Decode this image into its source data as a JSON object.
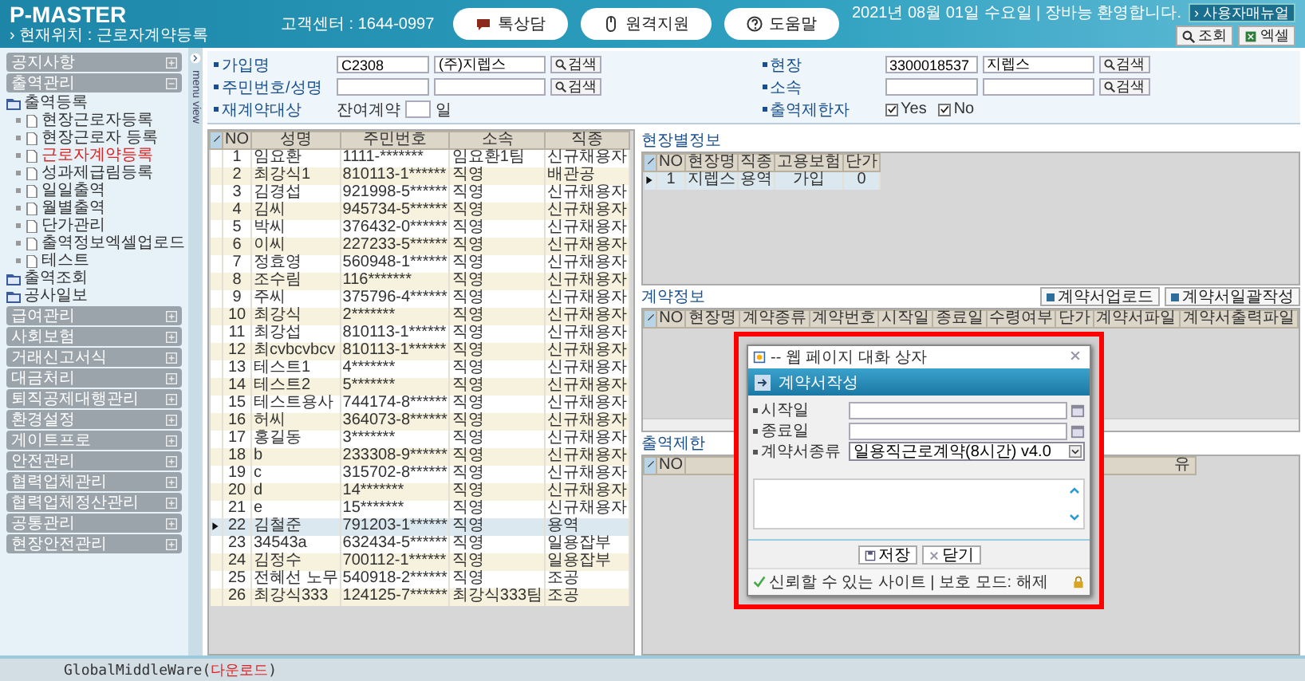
{
  "header": {
    "logo": "P-MASTER",
    "breadcrumb": "› 현재위치 : 근로자계약등록",
    "support": "고객센터 : 1644-0997",
    "pills": [
      {
        "kind": "chat",
        "label": "톡상담"
      },
      {
        "kind": "mouse",
        "label": "원격지원"
      },
      {
        "kind": "help",
        "label": "도움말"
      }
    ],
    "greeting": "2021년 08월 01일 수요일 | 장바능 환영합니다.",
    "manual_button": "› 사용자매뉴얼",
    "tools": [
      {
        "kind": "search",
        "label": "조회"
      },
      {
        "kind": "excel",
        "label": "엑셀"
      }
    ]
  },
  "sidebar": {
    "toggle_label": "menu view",
    "sections": [
      {
        "label": "공지사항",
        "expanded": false
      },
      {
        "label": "출역관리",
        "expanded": true,
        "children": [
          {
            "label": "출역등록",
            "children": [
              {
                "label": "현장근로자등록",
                "selected": false
              },
              {
                "label": "현장근로자 등록",
                "selected": false
              },
              {
                "label": "근로자계약등록",
                "selected": true
              },
              {
                "label": "성과제급림등록",
                "selected": false
              },
              {
                "label": "일일출역",
                "selected": false
              },
              {
                "label": "월별출역",
                "selected": false
              },
              {
                "label": "단가관리",
                "selected": false
              },
              {
                "label": "출역정보엑셀업로드",
                "selected": false
              },
              {
                "label": "테스트",
                "selected": false
              }
            ]
          },
          {
            "label": "출역조회"
          },
          {
            "label": "공사일보"
          }
        ]
      },
      {
        "label": "급여관리",
        "expanded": false
      },
      {
        "label": "사회보험",
        "expanded": false
      },
      {
        "label": "거래신고서식",
        "expanded": false
      },
      {
        "label": "대금처리",
        "expanded": false
      },
      {
        "label": "퇴직공제대행관리",
        "expanded": false
      },
      {
        "label": "환경설정",
        "expanded": false
      },
      {
        "label": "게이트프로",
        "expanded": false
      },
      {
        "label": "안전관리",
        "expanded": false
      },
      {
        "label": "협력업체관리",
        "expanded": false
      },
      {
        "label": "협력업체정산관리",
        "expanded": false
      },
      {
        "label": "공통관리",
        "expanded": false
      },
      {
        "label": "현장안전관리",
        "expanded": false
      }
    ]
  },
  "filters": [
    {
      "kind": "lookup",
      "label": "가입명",
      "code": "C2308",
      "name": "(주)지렙스",
      "button": "검색"
    },
    {
      "kind": "lookup",
      "label": "현장",
      "code": "3300018537",
      "name": "지렙스",
      "button": "검색"
    },
    {
      "kind": "lookup",
      "label": "주민번호/성명",
      "button": "검색"
    },
    {
      "kind": "lookup",
      "label": "소속",
      "button": "검색"
    },
    {
      "kind": "days",
      "label": "재계약대상",
      "prefix": "잔여계약",
      "unit": "일"
    },
    {
      "kind": "checks",
      "label": "출역제한자",
      "options": [
        {
          "label": "Yes",
          "checked": true
        },
        {
          "label": "No",
          "checked": true
        }
      ]
    }
  ],
  "workers": {
    "columns": [
      "NO",
      "성명",
      "주민번호",
      "소속",
      "직종"
    ],
    "rows": [
      {
        "cells": [
          "1",
          "임요환",
          "1111-*******",
          "임요환1팀",
          "신규채용자"
        ],
        "selected": false
      },
      {
        "cells": [
          "2",
          "최강식1",
          "810113-1******",
          "직영",
          "배관공"
        ],
        "selected": false
      },
      {
        "cells": [
          "3",
          "김경섭",
          "921998-5******",
          "직영",
          "신규채용자"
        ],
        "selected": false
      },
      {
        "cells": [
          "4",
          "김씨",
          "945734-5******",
          "직영",
          "신규채용자"
        ],
        "selected": false
      },
      {
        "cells": [
          "5",
          "박씨",
          "376432-0******",
          "직영",
          "신규채용자"
        ],
        "selected": false
      },
      {
        "cells": [
          "6",
          "이씨",
          "227233-5******",
          "직영",
          "신규채용자"
        ],
        "selected": false
      },
      {
        "cells": [
          "7",
          "정효영",
          "560948-1******",
          "직영",
          "신규채용자"
        ],
        "selected": false
      },
      {
        "cells": [
          "8",
          "조수림",
          "116*******",
          "직영",
          "신규채용자"
        ],
        "selected": false
      },
      {
        "cells": [
          "9",
          "주씨",
          "375796-4******",
          "직영",
          "신규채용자"
        ],
        "selected": false
      },
      {
        "cells": [
          "10",
          "최강식",
          "2*******",
          "직영",
          "신규채용자"
        ],
        "selected": false
      },
      {
        "cells": [
          "11",
          "최강섭",
          "810113-1******",
          "직영",
          "신규채용자"
        ],
        "selected": false
      },
      {
        "cells": [
          "12",
          "최cvbcvbcv",
          "810113-1******",
          "직영",
          "신규채용자"
        ],
        "selected": false
      },
      {
        "cells": [
          "13",
          "테스트1",
          "4*******",
          "직영",
          "신규채용자"
        ],
        "selected": false
      },
      {
        "cells": [
          "14",
          "테스트2",
          "5*******",
          "직영",
          "신규채용자"
        ],
        "selected": false
      },
      {
        "cells": [
          "15",
          "테스트용사",
          "744174-8******",
          "직영",
          "신규채용자"
        ],
        "selected": false
      },
      {
        "cells": [
          "16",
          "허씨",
          "364073-8******",
          "직영",
          "신규채용자"
        ],
        "selected": false
      },
      {
        "cells": [
          "17",
          "홍길동",
          "3*******",
          "직영",
          "신규채용자"
        ],
        "selected": false
      },
      {
        "cells": [
          "18",
          "b",
          "233308-9******",
          "직영",
          "신규채용자"
        ],
        "selected": false
      },
      {
        "cells": [
          "19",
          "c",
          "315702-8******",
          "직영",
          "신규채용자"
        ],
        "selected": false
      },
      {
        "cells": [
          "20",
          "d",
          "14*******",
          "직영",
          "신규채용자"
        ],
        "selected": false
      },
      {
        "cells": [
          "21",
          "e",
          "15*******",
          "직영",
          "신규채용자"
        ],
        "selected": false
      },
      {
        "cells": [
          "22",
          "김철준",
          "791203-1******",
          "직영",
          "용역"
        ],
        "selected": true
      },
      {
        "cells": [
          "23",
          "34543a",
          "632434-5******",
          "직영",
          "일용잡부"
        ],
        "selected": false
      },
      {
        "cells": [
          "24",
          "김정수",
          "700112-1******",
          "직영",
          "일용잡부"
        ],
        "selected": false
      },
      {
        "cells": [
          "25",
          "전혜선 노무",
          "540918-2******",
          "직영",
          "조공"
        ],
        "selected": false
      },
      {
        "cells": [
          "26",
          "최강식333",
          "124125-7******",
          "최강식333팀",
          "조공"
        ],
        "selected": false
      }
    ]
  },
  "site_info": {
    "title": "현장별정보",
    "columns": [
      "NO",
      "현장명",
      "직종",
      "고용보험",
      "단가"
    ],
    "rows": [
      {
        "cells": [
          "1",
          "지렙스",
          "용역",
          "가입",
          "0"
        ],
        "selected": true
      }
    ]
  },
  "contract_info": {
    "title": "계약정보",
    "buttons": [
      "계약서업로드",
      "계약서일괄작성"
    ],
    "columns": [
      "NO",
      "현장명",
      "계약종류",
      "계약번호",
      "시작일",
      "종료일",
      "수령여부",
      "단가",
      "계약서파일",
      "계약서출력파일"
    ]
  },
  "restriction": {
    "title": "출역제한",
    "columns": [
      "NO",
      "유"
    ]
  },
  "dialog": {
    "title": "-- 웹 페이지 대화 상자",
    "heading": "계약서작성",
    "fields": [
      {
        "kind": "date",
        "label": "시작일"
      },
      {
        "kind": "date",
        "label": "종료일"
      },
      {
        "kind": "select",
        "label": "계약서종류",
        "value": "일용직근로계약(8시간) v4.0"
      }
    ],
    "buttons": [
      {
        "kind": "save",
        "label": "저장"
      },
      {
        "kind": "close",
        "label": "닫기"
      }
    ],
    "status": "신뢰할 수 있는 사이트 | 보호 모드: 해제"
  },
  "footer": {
    "prefix": "GlobalMiddleWare(",
    "link": "다운로드",
    "suffix": ")"
  }
}
